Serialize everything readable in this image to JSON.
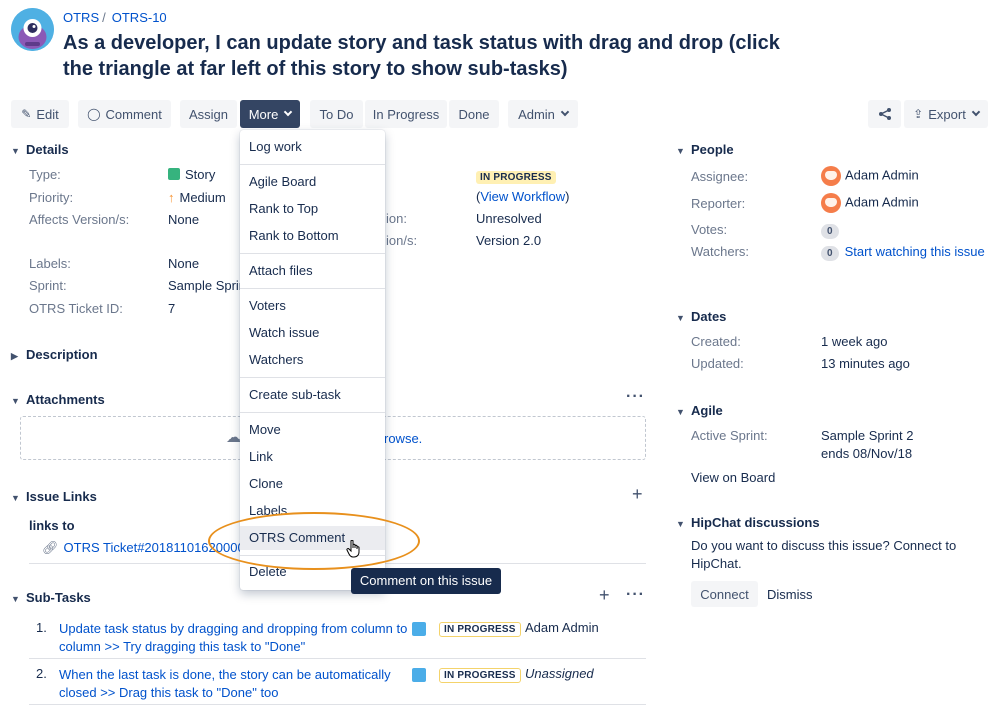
{
  "breadcrumb": {
    "project": "OTRS",
    "issue_key": "OTRS-10"
  },
  "issue": {
    "title": "As a developer, I can update story and task status with drag and drop (click the triangle at far left of this story to show sub-tasks)"
  },
  "toolbar": {
    "edit": "Edit",
    "comment": "Comment",
    "assign": "Assign",
    "more": "More",
    "todo": "To Do",
    "in_progress": "In Progress",
    "done": "Done",
    "admin": "Admin",
    "export": "Export"
  },
  "details": {
    "heading": "Details",
    "type_label": "Type:",
    "type_value": "Story",
    "priority_label": "Priority:",
    "priority_value": "Medium",
    "affects_label": "Affects Version/s:",
    "affects_value": "None",
    "labels_label": "Labels:",
    "labels_value": "None",
    "sprint_label": "Sprint:",
    "sprint_value": "Sample Sprin",
    "ticket_label": "OTRS Ticket ID:",
    "ticket_value": "7",
    "status_value": "IN PROGRESS",
    "view_workflow": "View Workflow",
    "resolution_label_part": "ion:",
    "resolution_value": "Unresolved",
    "fix_label_part": "ion/s:",
    "fix_value": "Version 2.0"
  },
  "description": {
    "heading": "Description"
  },
  "attachments": {
    "heading": "Attachments",
    "browse_part": "rowse."
  },
  "issue_links": {
    "heading": "Issue Links",
    "links_to": "links to",
    "link_text": "OTRS Ticket#20181101620000"
  },
  "more_menu": {
    "items": [
      "Log work",
      "Agile Board",
      "Rank to Top",
      "Rank to Bottom",
      "Attach files",
      "Voters",
      "Watch issue",
      "Watchers",
      "Create sub-task",
      "Move",
      "Link",
      "Clone",
      "Labels",
      "OTRS Comment",
      "Delete"
    ]
  },
  "tooltip": {
    "text": "Comment on this issue"
  },
  "subtasks": {
    "heading": "Sub-Tasks",
    "rows": [
      {
        "num": "1.",
        "summary_line1": "Update task status by dragging and dropping from column to",
        "summary_line2": "column >> Try dragging this task to \"Done\"",
        "status": "IN PROGRESS",
        "assignee": "Adam Admin"
      },
      {
        "num": "2.",
        "summary_line1": "When the last task is done, the story can be automatically",
        "summary_line2": "closed >> Drag this task to \"Done\" too",
        "status": "IN PROGRESS",
        "assignee": "Unassigned"
      }
    ]
  },
  "people": {
    "heading": "People",
    "assignee_label": "Assignee:",
    "assignee": "Adam Admin",
    "reporter_label": "Reporter:",
    "reporter": "Adam Admin",
    "votes_label": "Votes:",
    "votes": "0",
    "watchers_label": "Watchers:",
    "watchers": "0",
    "start_watching": "Start watching this issue"
  },
  "dates": {
    "heading": "Dates",
    "created_label": "Created:",
    "created": "1 week ago",
    "updated_label": "Updated:",
    "updated": "13 minutes ago"
  },
  "agile": {
    "heading": "Agile",
    "active_sprint_label": "Active Sprint:",
    "sprint": "Sample Sprint 2",
    "ends": "ends 08/Nov/18",
    "view_on_board": "View on Board"
  },
  "hipchat": {
    "heading": "HipChat discussions",
    "question_line1": "Do you want to discuss this issue? Connect to",
    "question_line2": "HipChat.",
    "connect": "Connect",
    "dismiss": "Dismiss"
  },
  "colors": {
    "in_progress_lozenge": "#fff0b3",
    "active_button": "#344563",
    "link": "#0052cc",
    "highlight_ring": "#e8901c"
  }
}
